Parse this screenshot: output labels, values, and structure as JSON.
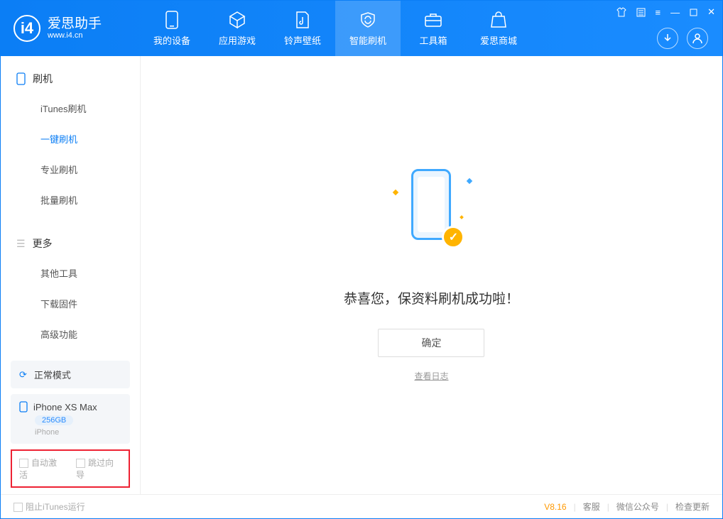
{
  "app": {
    "title": "爱思助手",
    "subtitle": "www.i4.cn"
  },
  "header_tabs": [
    {
      "label": "我的设备"
    },
    {
      "label": "应用游戏"
    },
    {
      "label": "铃声壁纸"
    },
    {
      "label": "智能刷机"
    },
    {
      "label": "工具箱"
    },
    {
      "label": "爱思商城"
    }
  ],
  "sidebar": {
    "flash": {
      "title": "刷机",
      "items": [
        "iTunes刷机",
        "一键刷机",
        "专业刷机",
        "批量刷机"
      ],
      "active_index": 1
    },
    "more": {
      "title": "更多",
      "items": [
        "其他工具",
        "下载固件",
        "高级功能"
      ]
    },
    "mode": "正常模式",
    "device": {
      "name": "iPhone XS Max",
      "storage": "256GB",
      "type": "iPhone"
    },
    "options": {
      "auto_activate": "自动激活",
      "skip_guide": "跳过向导"
    }
  },
  "main": {
    "success_title": "恭喜您，保资料刷机成功啦！",
    "ok_button": "确定",
    "view_log": "查看日志"
  },
  "footer": {
    "block_itunes": "阻止iTunes运行",
    "version": "V8.16",
    "service": "客服",
    "wechat": "微信公众号",
    "update": "检查更新"
  }
}
